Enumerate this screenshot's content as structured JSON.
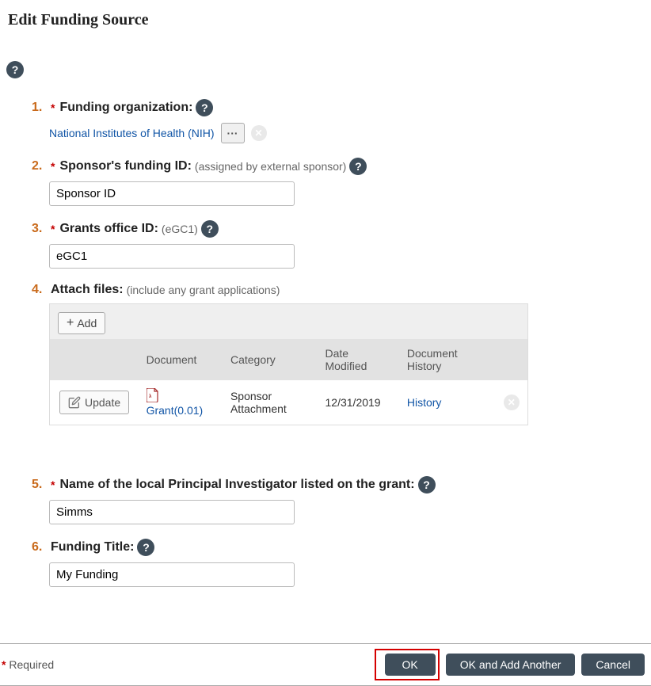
{
  "page_title": "Edit Funding Source",
  "fields": {
    "f1": {
      "num": "1.",
      "label": "Funding organization:",
      "required": true,
      "value_link": "National Institutes of Health (NIH)",
      "ellipsis_label": "···"
    },
    "f2": {
      "num": "2.",
      "label": "Sponsor's funding ID:",
      "hint": "(assigned by external sponsor)",
      "required": true,
      "value": "Sponsor ID"
    },
    "f3": {
      "num": "3.",
      "label": "Grants office ID:",
      "hint": "(eGC1)",
      "required": true,
      "value": "eGC1"
    },
    "f4": {
      "num": "4.",
      "label": "Attach files:",
      "hint": "(include any grant applications)",
      "required": false
    },
    "f5": {
      "num": "5.",
      "label": "Name of the local Principal Investigator listed on the grant:",
      "required": true,
      "value": "Simms"
    },
    "f6": {
      "num": "6.",
      "label": "Funding Title:",
      "required": false,
      "value": "My Funding"
    }
  },
  "attach": {
    "add_label": "Add",
    "update_label": "Update",
    "headers": {
      "document": "Document",
      "category": "Category",
      "date": "Date Modified",
      "history": "Document History"
    },
    "row": {
      "doc_name": "Grant(0.01)",
      "category": "Sponsor Attachment",
      "date": "12/31/2019",
      "history": "History"
    }
  },
  "footer": {
    "required_label": "Required",
    "ok": "OK",
    "ok_add": "OK and Add Another",
    "cancel": "Cancel"
  },
  "help_glyph": "?"
}
